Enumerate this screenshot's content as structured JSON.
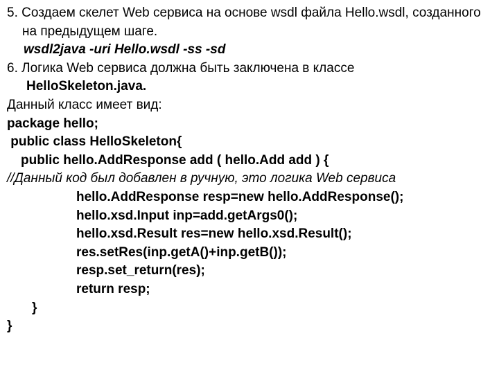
{
  "lines": {
    "l5a": "5. Создаем скелет Web сервиса на основе wsdl файла Hello.wsdl, созданного на предыдущем шаге.",
    "wsdl": "wsdl2java -uri Hello.wsdl -ss -sd",
    "l6a": "6. Логика Web сервиса должна быть заключена в классе",
    "l6b": "HelloSkeleton.java.",
    "desc": "Данный класс имеет вид:",
    "pkg": "package hello;",
    "cls": " public class HelloSkeleton{",
    "method": "public hello.AddResponse add ( hello.Add add ) {",
    "comment": "//Данный код был добавлен в ручную, это логика Web сервиса",
    "c1": "hello.AddResponse resp=new hello.AddResponse();",
    "c2": "hello.xsd.Input inp=add.getArgs0();",
    "c3": "hello.xsd.Result res=new hello.xsd.Result();",
    "c4": "res.setRes(inp.getA()+inp.getB());",
    "c5": "resp.set_return(res);",
    "c6": "return resp;",
    "brace1": "}",
    "brace2": "}"
  }
}
